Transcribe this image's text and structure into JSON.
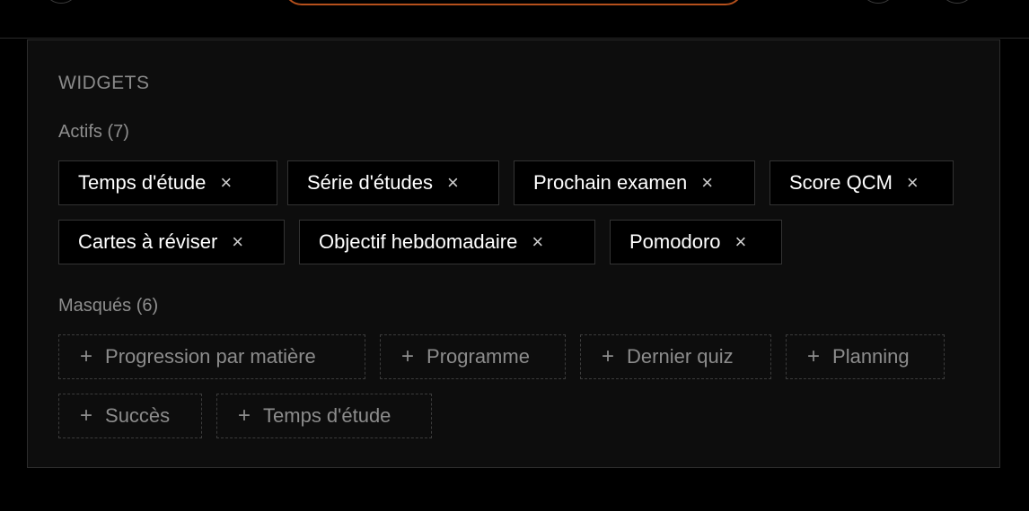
{
  "widgets": {
    "title": "WIDGETS",
    "active_label": "Actifs (7)",
    "active": [
      {
        "label": "Temps d'étude"
      },
      {
        "label": "Série d'études"
      },
      {
        "label": "Prochain examen"
      },
      {
        "label": "Score QCM"
      },
      {
        "label": "Cartes à réviser"
      },
      {
        "label": "Objectif hebdomadaire"
      },
      {
        "label": "Pomodoro"
      }
    ],
    "hidden_label": "Masqués (6)",
    "hidden": [
      {
        "label": "Progression par matière"
      },
      {
        "label": "Programme"
      },
      {
        "label": "Dernier quiz"
      },
      {
        "label": "Planning"
      },
      {
        "label": "Succès"
      },
      {
        "label": "Temps d'étude"
      }
    ],
    "icons": {
      "remove": "×",
      "add": "+"
    }
  },
  "colors": {
    "accent": "#b5501c",
    "panel_bg": "#0d0d0d",
    "page_bg": "#000000"
  }
}
